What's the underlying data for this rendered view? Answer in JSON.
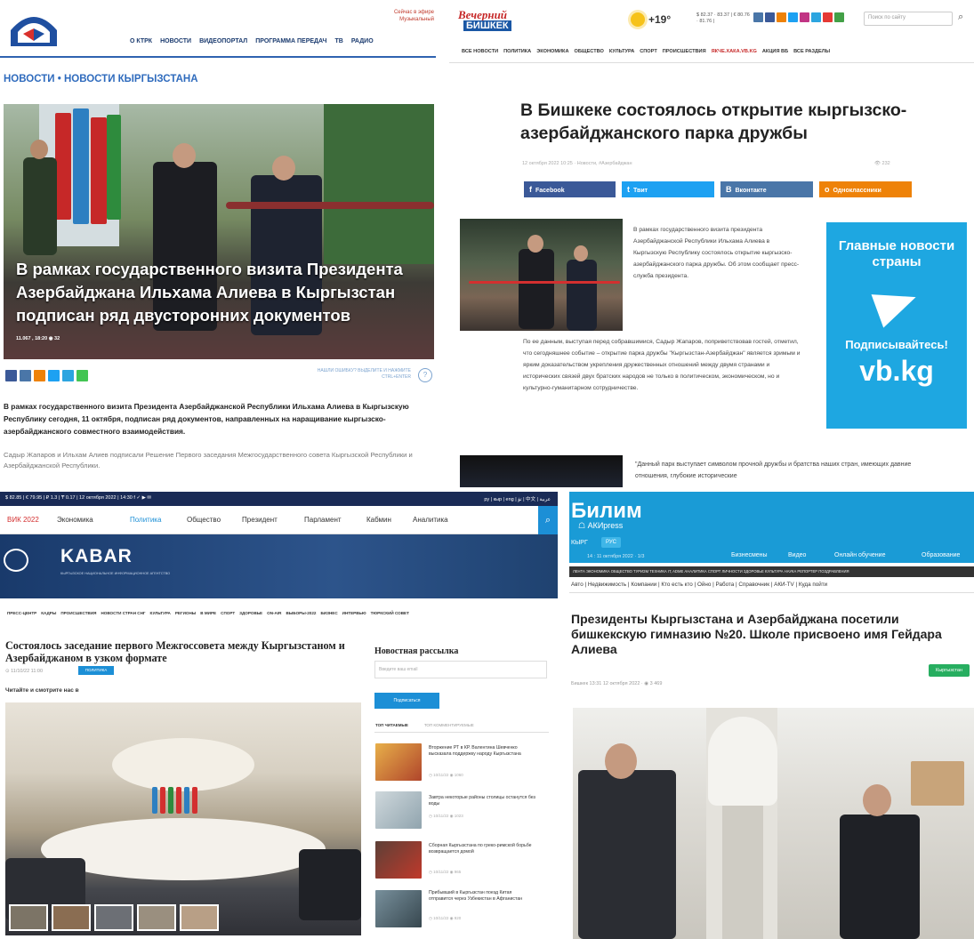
{
  "p1": {
    "on_air": [
      "Сейчас в эфире",
      "Музыкальный"
    ],
    "nav": [
      "О КТРК",
      "НОВОСТИ",
      "ВИДЕОПОРТАЛ",
      "ПРОГРАММА ПЕРЕДАЧ",
      "ТВ",
      "РАДИО"
    ],
    "breadcrumb": "НОВОСТИ • НОВОСТИ КЫРГЫЗСТАНА",
    "overlay_title": "В рамках государственного визита Президента Азербайджана Ильхама Алиева в Кыргызстан подписан ряд двусторонних документов",
    "stats": "11.067 , 18:20  ◉ 32",
    "note": "НАШЛИ ОШИБКУ? ВЫДЕЛИТЕ И НАЖМИТЕ CTRL+ENTER",
    "lead": "В рамках государственного визита Президента Азербайджанской Республики Ильхама Алиева в Кыргызскую Республику сегодня, 11 октября, подписан ряд документов, направленных на наращивание кыргызско-азербайджанского совместного взаимодействия.",
    "sub": "Садыр Жапаров и Ильхам Алиев подписали Решение Первого заседания Межгосударственного совета Кыргызской Республики и Азербайджанской Республики."
  },
  "p2": {
    "logo_top": "Вечерний",
    "logo_bottom": "БИШКЕК",
    "temperature": "+19°",
    "rates": "$ 82.37 · 83.37 | € 80.76 · 81.76 |",
    "search_placeholder": "Поиск по сайту",
    "nav": [
      "ВСЕ НОВОСТИ",
      "ПОЛИТИКА",
      "ЭКОНОМИКА",
      "ОБЩЕСТВО",
      "КУЛЬТУРА",
      "СПОРТ",
      "ПРОИСШЕСТВИЯ",
      "ЯКЧЕ.ХАКА.VB.KG",
      "АКЦИЯ ВБ",
      "ВСЕ РАЗДЕЛЫ"
    ],
    "title": "В Бишкеке состоялось открытие кыргызско-азербайджанского парка дружбы",
    "meta": "12 октября 2022 10:25 · Новости, #Азербайджан",
    "views": "👁 232",
    "share": [
      {
        "icon": "f",
        "label": "Facebook",
        "color": "#3b5998"
      },
      {
        "icon": "t",
        "label": "Твит",
        "color": "#1da1f2"
      },
      {
        "icon": "B",
        "label": "Вконтакте",
        "color": "#4a76a8"
      },
      {
        "icon": "o",
        "label": "Одноклассники",
        "color": "#ee8208"
      }
    ],
    "para1": "В рамках государственного визита президента Азербайджанской Республики Ильхама Алиева в Кыргызскую Республику состоялось открытие кыргызско-азербайджанского парка дружбы. Об этом сообщает пресс-служба президента.",
    "para2": "По ее данным, выступая перед собравшимися, Садыр Жапаров, поприветствовав гостей, отметил, что сегодняшнее событие – открытие парка дружбы \"Кыргызстан-Азербайджан\" является зримым и ярким доказательством укрепления дружественных отношений между двумя странами и исторических связей двух братских народов не только в политическом, экономическом, но и культурно-гуманитарном сотрудничестве.",
    "ad": {
      "line1": "Главные новости страны",
      "line2": "Подписывайтесь!",
      "line3": "vb.kg"
    },
    "quote": "\"Данный парк выступает символом прочной дружбы и братства наших стран, имеющих давние отношения, глубокие исторические"
  },
  "p3": {
    "topbar": "$ 82.85 | € 79.95 | ₽ 1.3 | ₸ 0.17  |  12 октября 2022 | 14:30   f ✓ ▶ ✉",
    "langs": "ру | кыр | eng | تۈ | 中文 | عربية",
    "menu": [
      "ВИК 2022",
      "Экономика",
      "Политика",
      "Общество",
      "Президент",
      "Парламент",
      "Кабмин",
      "Аналитика"
    ],
    "logo": "KABAR",
    "logo_sub": "КЫРГЫЗСКОЕ НАЦИОНАЛЬНОЕ ИНФОРМАЦИОННОЕ АГЕНТСТВО",
    "nav": [
      "ПРЕСС-ЦЕНТР",
      "КАДРЫ",
      "ПРОИСШЕСТВИЯ",
      "НОВОСТИ СТРАН СНГ",
      "КУЛЬТУРА",
      "РЕГИОНЫ",
      "В МИРЕ",
      "СПОРТ",
      "ЗДОРОВЬЕ",
      "ON-AIR",
      "ВЫБОРЫ-2022",
      "БИЗНЕС",
      "ИНТЕРВЬЮ",
      "ТЮРКСКИЙ СОВЕТ"
    ],
    "title": "Состоялось заседание первого Межгоссовета между Кыргызстаном и Азербайджаном в узком формате",
    "date": "⊙ 11/10/22 11:00",
    "tag": "ПОЛИТИКА",
    "read_prompt": "Читайте и смотрите нас в",
    "newsletter": "Новостная рассылка",
    "email_placeholder": "Введите ваш email",
    "subscribe": "Подписаться",
    "tab_active": "ТОП ЧИТАЕМЫЕ",
    "tab_other": "ТОП КОММЕНТИРУЕМЫЕ",
    "news": [
      {
        "text": "Вторжение РТ в КР. Валентина Шевченко высказала поддержку народу Кыргызстана",
        "meta": "◷ 10/11/22  ◉ 1060"
      },
      {
        "text": "Завтра некоторые районы столицы останутся без воды",
        "meta": "◷ 10/11/22  ◉ 1023"
      },
      {
        "text": "Сборная Кыргызстана по греко-римской борьбе возвращается домой",
        "meta": "◷ 10/11/22  ◉ 965"
      },
      {
        "text": "Прибывший в Кыргызстан поезд Китая отправится через Узбекистан в Афганистан",
        "meta": "◷ 10/11/22  ◉ 920"
      }
    ]
  },
  "p4": {
    "logo": "Билим",
    "logo_sub": "☖ АКИpress",
    "lang": "КЫРГ",
    "lang_btn": "РУС",
    "date": "14 : 11 октября 2022 · 1/3",
    "header_nav": [
      "Бизнесмены",
      "Видео",
      "Онлайн обучение",
      "Образование"
    ],
    "strip1": "ЛЕНТА  ЭКОНОМИКА  ОБЩЕСТВО  ТУРИЗМ  ТЕХНИКА  IT, ADME  АНАЛИТИКА  СПОРТ  ЛИЧНОСТИ  ЗДОРОВЬЕ  КУЛЬТУРА  НАУКА  РЕПОРТЕР  ПОЗДРАВЛЕНИЯ",
    "strip2": "Авто | Недвижимость | Компании | Кто есть кто | Ойно | Работа | Справочник | АКИ-TV | Куда пойти",
    "title": "Президенты Кыргызстана и Азербайджана посетили бишкекскую гимназию №20. Школе присвоено имя Гейдара Алиева",
    "meta": "Бишкек 13:31 12 октября 2022 · ◉ 3 469",
    "category": "Кыргызстан"
  },
  "colors": {
    "ktrk_blue": "#2f6bbd",
    "vb_blue": "#1a57a5",
    "kabar_navy": "#1a2b56",
    "akipress_blue": "#1a9bd6"
  }
}
